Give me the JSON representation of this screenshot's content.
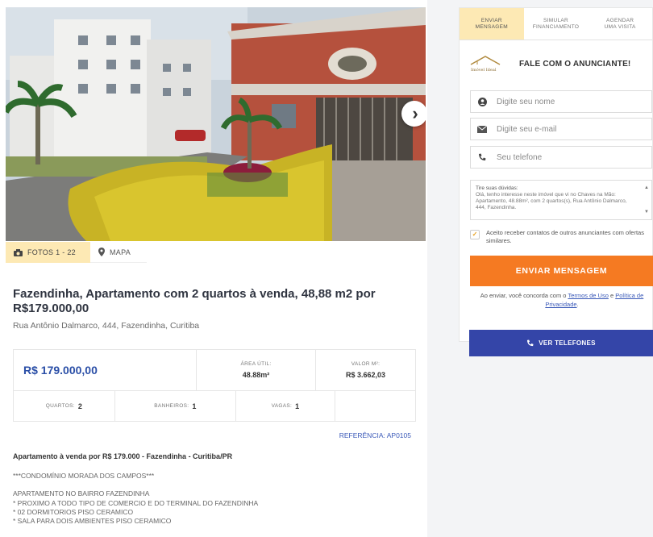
{
  "gallery": {
    "next_icon": "chevron-right-icon",
    "tabs": [
      {
        "icon": "camera-icon",
        "label": "FOTOS  1 - 22"
      },
      {
        "icon": "map-pin-icon",
        "label": "MAPA"
      }
    ]
  },
  "listing": {
    "title": "Fazendinha, Apartamento com 2 quartos à venda, 48,88 m2 por R$179.000,00",
    "address": "Rua Antônio Dalmarco, 444, Fazendinha, Curitiba",
    "price": "R$ 179.000,00",
    "area_label": "ÁREA ÚTIL:",
    "area_value": "48.88m²",
    "valor_m2_label": "VALOR M²:",
    "valor_m2_value": "R$ 3.662,03",
    "quartos_label": "QUARTOS:",
    "quartos_value": "2",
    "banheiros_label": "BANHEIROS:",
    "banheiros_value": "1",
    "vagas_label": "VAGAS:",
    "vagas_value": "1",
    "reference": "REFERÊNCIA: AP0105"
  },
  "description": {
    "heading": "Apartamento à venda por R$ 179.000 - Fazendinha - Curitiba/PR",
    "lines": [
      "***CONDOMÍNIO MORADA DOS CAMPOS***",
      "",
      "APARTAMENTO NO BAIRRO FAZENDINHA",
      "* PROXIMO A TODO TIPO DE COMERCIO E DO TERMINAL DO FAZENDINHA",
      "* 02 DORMITORIOS PISO CERAMICO",
      "* SALA PARA DOIS AMBIENTES PISO CERAMICO"
    ]
  },
  "contact_form": {
    "tabs": [
      {
        "line1": "ENVIAR",
        "line2": "MENSAGEM"
      },
      {
        "line1": "SIMULAR",
        "line2": "FINANCIAMENTO"
      },
      {
        "line1": "AGENDAR",
        "line2": "UMA VISITA"
      }
    ],
    "logo_text": "Imóvel Ideal",
    "heading": "FALE COM O ANUNCIANTE!",
    "name_placeholder": "Digite seu nome",
    "email_placeholder": "Digite seu e-mail",
    "phone_placeholder": "Seu telefone",
    "message_heading": "Tire suas dúvidas:",
    "message_body": "Olá, tenho interesse neste imóvel que vi no Chaves na Mão: Apartamento, 48.88m², com 2 quartos(s), Rua Antônio Dalmarco, 444, Fazendinha.",
    "consent_text": "Aceito receber contatos de outros anunciantes com ofertas similares.",
    "send_label": "ENVIAR MENSAGEM",
    "terms_prefix": "Ao enviar, você concorda com o ",
    "terms_link1": "Termos de Uso",
    "terms_mid": " e ",
    "terms_link2": "Política de Privacidade",
    "terms_suffix": "."
  },
  "phones_button": {
    "label": "VER TELEFONES",
    "icon": "phone-icon"
  },
  "colors": {
    "accent_orange": "#f57a22",
    "active_tab_bg": "#fde9b4",
    "price_blue": "#2b4fa7",
    "phones_button_bg": "#3445a8"
  }
}
